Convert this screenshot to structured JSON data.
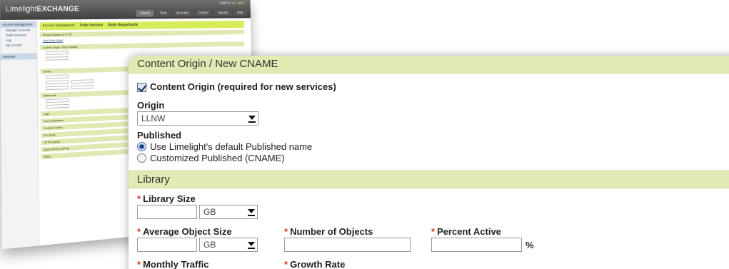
{
  "background_screenshot": {
    "logo_light": "Limelight",
    "logo_bold": "EXCHANGE",
    "user_text": "logged in as",
    "user_link": "Logout",
    "nav": [
      "Search",
      "Tools",
      "Accounts",
      "Content",
      "Support",
      "Help"
    ],
    "sidebar": {
      "header": "Account Management",
      "items": [
        "Manage Accounts",
        "Order Services",
        "Log",
        "My Account"
      ],
      "favorites": "Favorites"
    },
    "tabs": [
      "Account Management",
      "Order Services",
      "Radio Margaritaville"
    ],
    "sections": [
      "Product Details for HTTP",
      "Content Origin / New CNAME",
      "Library",
      "Watermark",
      "Logs",
      "Geo Compliance",
      "Content Control",
      "FLV Seek",
      "HTTP Upload",
      "Query String Caching",
      "Notes"
    ],
    "link_text": "View Price Sheet"
  },
  "content_origin": {
    "header": "Content Origin / New CNAME",
    "checkbox_label": "Content Origin (required for new services)",
    "origin_label": "Origin",
    "origin_value": "LLNW",
    "published_label": "Published",
    "radio_default": "Use Limelight's default Published name",
    "radio_custom": "Customized Published (CNAME)"
  },
  "library": {
    "header": "Library",
    "library_size_label": "Library Size",
    "library_size_unit": "GB",
    "avg_object_size_label": "Average Object Size",
    "avg_object_size_unit": "GB",
    "num_objects_label": "Number of Objects",
    "percent_active_label": "Percent Active",
    "percent_symbol": "%",
    "monthly_traffic_label": "Monthly Traffic",
    "growth_rate_label": "Growth Rate",
    "required_marker": "*"
  }
}
